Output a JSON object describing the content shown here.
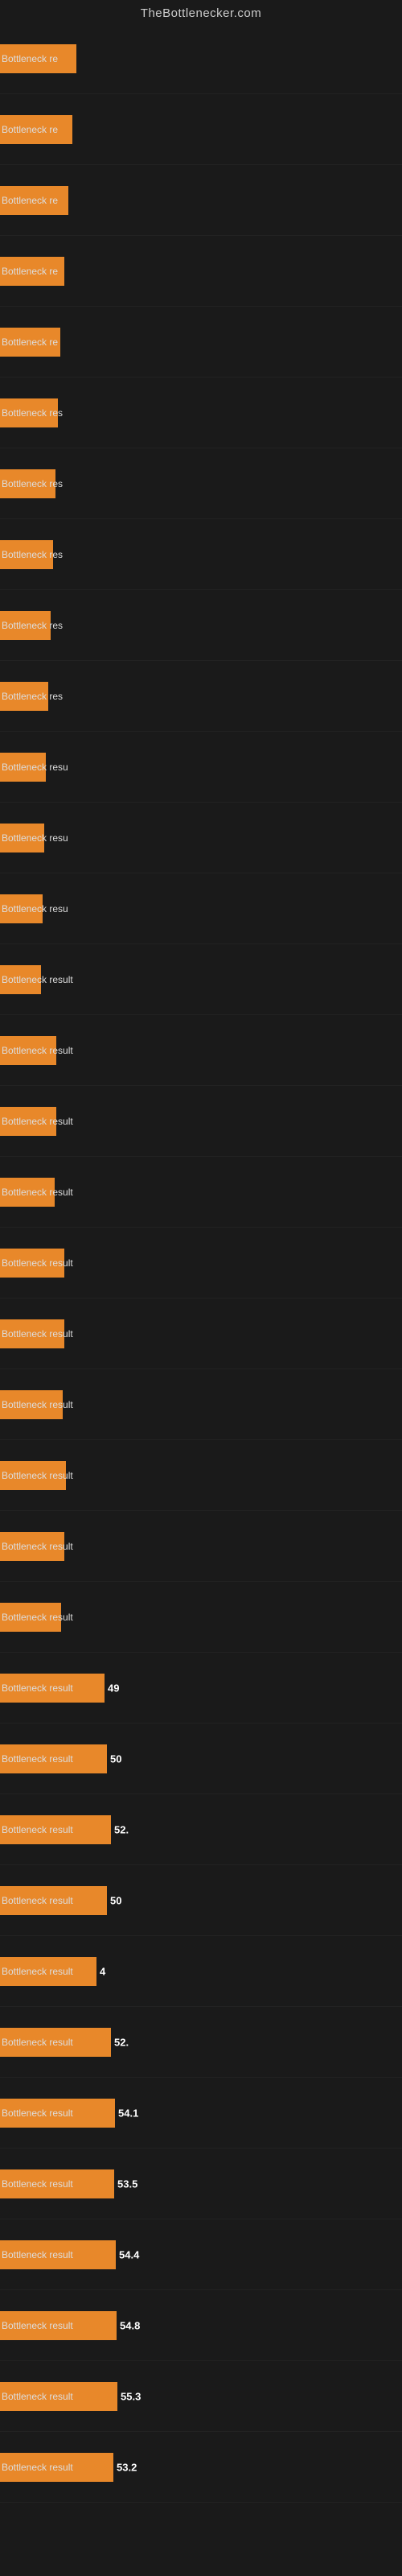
{
  "site": {
    "title": "TheBottlenecker.com"
  },
  "bars": [
    {
      "label": "Bottleneck re",
      "value": null,
      "width": 95
    },
    {
      "label": "Bottleneck re",
      "value": null,
      "width": 90
    },
    {
      "label": "Bottleneck re",
      "value": null,
      "width": 85
    },
    {
      "label": "Bottleneck re",
      "value": null,
      "width": 80
    },
    {
      "label": "Bottleneck re",
      "value": null,
      "width": 75
    },
    {
      "label": "Bottleneck res",
      "value": null,
      "width": 72
    },
    {
      "label": "Bottleneck res",
      "value": null,
      "width": 69
    },
    {
      "label": "Bottleneck res",
      "value": null,
      "width": 66
    },
    {
      "label": "Bottleneck res",
      "value": null,
      "width": 63
    },
    {
      "label": "Bottleneck res",
      "value": null,
      "width": 60
    },
    {
      "label": "Bottleneck resu",
      "value": null,
      "width": 57
    },
    {
      "label": "Bottleneck resu",
      "value": null,
      "width": 55
    },
    {
      "label": "Bottleneck resu",
      "value": null,
      "width": 53
    },
    {
      "label": "Bottleneck result",
      "value": null,
      "width": 51
    },
    {
      "label": "Bottleneck result",
      "value": null,
      "width": 70
    },
    {
      "label": "Bottleneck result",
      "value": null,
      "width": 70
    },
    {
      "label": "Bottleneck result",
      "value": null,
      "width": 68
    },
    {
      "label": "Bottleneck result",
      "value": null,
      "width": 80
    },
    {
      "label": "Bottleneck result",
      "value": null,
      "width": 80
    },
    {
      "label": "Bottleneck result",
      "value": null,
      "width": 78
    },
    {
      "label": "Bottleneck result",
      "value": null,
      "width": 82
    },
    {
      "label": "Bottleneck result",
      "value": null,
      "width": 80
    },
    {
      "label": "Bottleneck result",
      "value": null,
      "width": 76
    },
    {
      "label": "Bottleneck result",
      "value": "49",
      "width": 130
    },
    {
      "label": "Bottleneck result",
      "value": "50",
      "width": 133
    },
    {
      "label": "Bottleneck result",
      "value": "52.",
      "width": 138
    },
    {
      "label": "Bottleneck result",
      "value": "50",
      "width": 133
    },
    {
      "label": "Bottleneck result",
      "value": "4",
      "width": 120
    },
    {
      "label": "Bottleneck result",
      "value": "52.",
      "width": 138
    },
    {
      "label": "Bottleneck result",
      "value": "54.1",
      "width": 143
    },
    {
      "label": "Bottleneck result",
      "value": "53.5",
      "width": 142
    },
    {
      "label": "Bottleneck result",
      "value": "54.4",
      "width": 144
    },
    {
      "label": "Bottleneck result",
      "value": "54.8",
      "width": 145
    },
    {
      "label": "Bottleneck result",
      "value": "55.3",
      "width": 146
    },
    {
      "label": "Bottleneck result",
      "value": "53.2",
      "width": 141
    }
  ]
}
